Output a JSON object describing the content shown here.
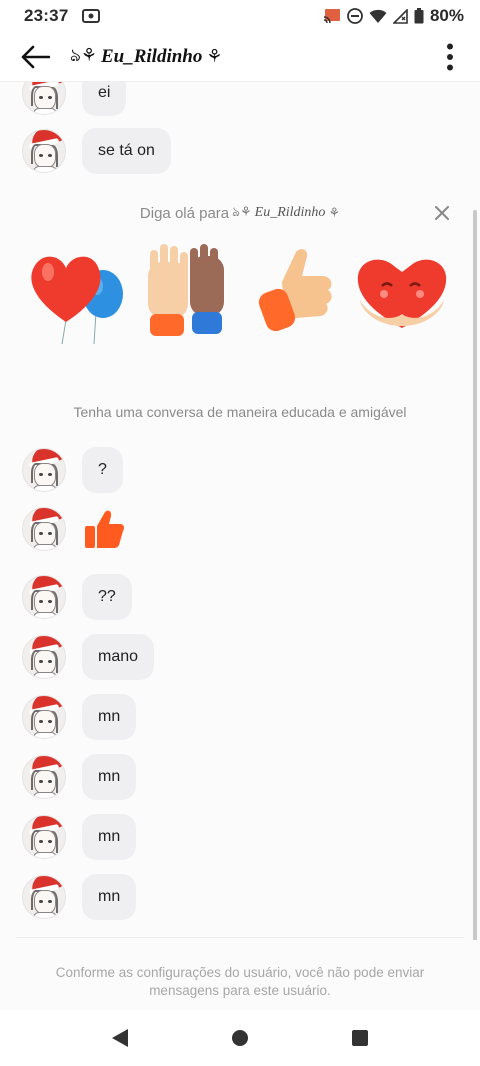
{
  "status_bar": {
    "time": "23:37",
    "battery": "80%",
    "icons": [
      "screen-record-icon",
      "cast-icon",
      "do-not-disturb-icon",
      "wifi-icon",
      "signal-icon",
      "battery-icon"
    ]
  },
  "header": {
    "title": "Eu_Rildinho",
    "deco_left": "ঌ⚘",
    "deco_right": "⚘",
    "back_icon": "back-arrow-icon",
    "menu_icon": "more-vertical-icon"
  },
  "messages_top": [
    {
      "text": "ei"
    },
    {
      "text": "se tá on"
    }
  ],
  "greeting": {
    "prefix": "Diga olá para",
    "name": "Eu_Rildinho",
    "deco_left": "ঌ⚘",
    "deco_right": "⚘",
    "close_icon": "close-icon",
    "stickers": [
      "heart-balloons-sticker",
      "high-five-sticker",
      "thumbs-up-sticker",
      "heart-hug-sticker"
    ],
    "hint": "Tenha uma conversa de maneira educada e amigável"
  },
  "messages_bottom": [
    {
      "text": "?"
    },
    {
      "text": "",
      "sticker": "thumbs-up-icon"
    },
    {
      "text": "??"
    },
    {
      "text": "mano"
    },
    {
      "text": "mn"
    },
    {
      "text": "mn"
    },
    {
      "text": "mn"
    },
    {
      "text": "mn"
    }
  ],
  "footer": {
    "notice": "Conforme as configurações do usuário, você não pode enviar mensagens para este usuário."
  },
  "nav": {
    "icons": [
      "nav-back-icon",
      "nav-home-icon",
      "nav-recents-icon"
    ]
  },
  "colors": {
    "accent_orange": "#ff5a1f",
    "bubble": "#efeff2",
    "santa_red": "#d9332b"
  }
}
